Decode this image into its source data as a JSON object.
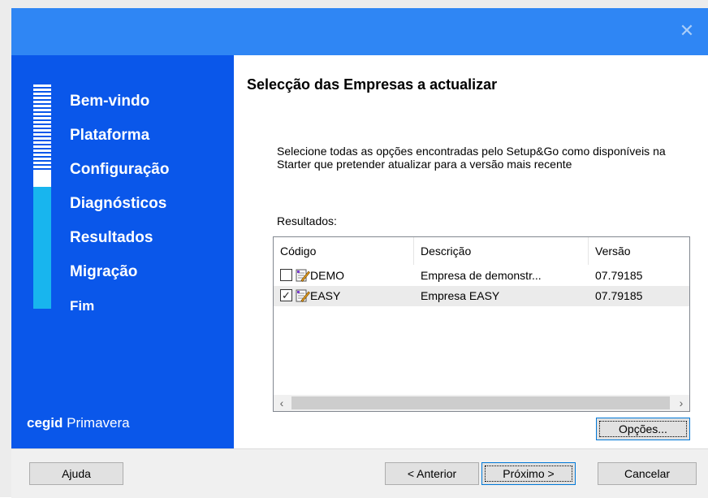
{
  "window": {
    "close_glyph": "✕"
  },
  "sidebar": {
    "steps": [
      {
        "label": "Bem-vindo"
      },
      {
        "label": "Plataforma"
      },
      {
        "label": "Configuração"
      },
      {
        "label": "Diagnósticos"
      },
      {
        "label": "Resultados"
      },
      {
        "label": "Migração"
      },
      {
        "label": "Fim"
      }
    ],
    "progress_fraction": 0.42,
    "brand_part1": "cegid",
    "brand_part2": "Primavera",
    "colors": {
      "background": "#0a57ea",
      "progress_track": "#18b5ee",
      "titlebar": "#2f86f4"
    }
  },
  "main": {
    "heading": "Selecção das Empresas a actualizar",
    "description": "Selecione todas as opções encontradas pelo Setup&Go como disponíveis na Starter que pretender atualizar para a versão mais recente",
    "results_label": "Resultados:",
    "table": {
      "columns": [
        "Código",
        "Descrição",
        "Versão"
      ],
      "rows": [
        {
          "code": "DEMO",
          "description": "Empresa de demonstr...",
          "version": "07.79185",
          "checked": false,
          "selected": false,
          "check_glyph": ""
        },
        {
          "code": "EASY",
          "description": "Empresa EASY",
          "version": "07.79185",
          "checked": true,
          "selected": true,
          "check_glyph": "✓"
        }
      ],
      "scroll_left_icon": "‹",
      "scroll_right_icon": "›"
    },
    "options_button": "Opções..."
  },
  "footer": {
    "help": "Ajuda",
    "previous": "< Anterior",
    "next": "Próximo >",
    "cancel": "Cancelar"
  }
}
